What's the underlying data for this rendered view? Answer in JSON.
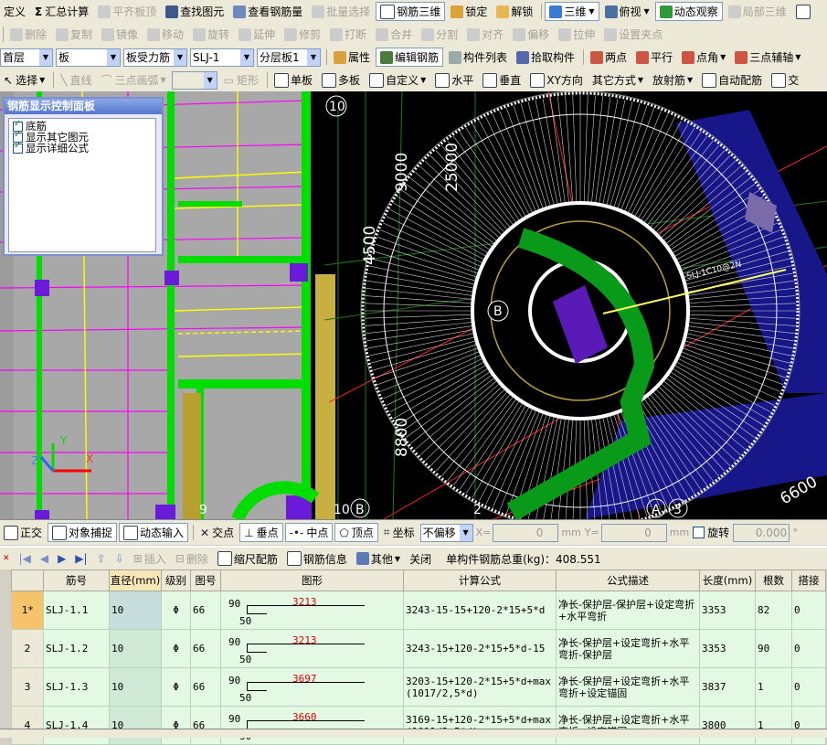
{
  "toolbar1": {
    "items": [
      {
        "label": "定义",
        "enabled": true
      },
      {
        "label": "汇总计算",
        "enabled": true
      },
      {
        "label": "平齐板顶",
        "enabled": false
      },
      {
        "label": "查找图元",
        "enabled": true
      },
      {
        "label": "查看钢筋量",
        "enabled": true
      },
      {
        "label": "批量选择",
        "enabled": false
      },
      {
        "label": "钢筋三维",
        "enabled": true,
        "active": true
      },
      {
        "label": "锁定",
        "enabled": true
      },
      {
        "label": "解锁",
        "enabled": true
      },
      {
        "label": "三维",
        "enabled": true,
        "active": true
      },
      {
        "label": "俯视",
        "enabled": true
      },
      {
        "label": "动态观察",
        "enabled": true,
        "active": true
      },
      {
        "label": "局部三维",
        "enabled": false
      }
    ]
  },
  "toolbar2": {
    "items": [
      "删除",
      "复制",
      "镜像",
      "移动",
      "旋转",
      "延伸",
      "修剪",
      "打断",
      "合并",
      "分割",
      "对齐",
      "偏移",
      "拉伸",
      "设置夹点"
    ]
  },
  "toolbar3": {
    "floor": "首层",
    "type": "板",
    "subtype": "板受力筋",
    "component": "SLJ-1",
    "layer": "分层板1",
    "buttons": [
      "属性",
      "编辑钢筋",
      "构件列表",
      "拾取构件",
      "两点",
      "平行",
      "点角",
      "三点辅轴"
    ],
    "active": "编辑钢筋"
  },
  "toolbar4": {
    "items": [
      "选择",
      "直线",
      "三点画弧",
      "矩形",
      "单板",
      "多板",
      "自定义",
      "水平",
      "垂直",
      "XY方向",
      "其它方式",
      "放射筋",
      "自动配筋",
      "交"
    ]
  },
  "panel": {
    "title": "钢筋显示控制面板",
    "options": [
      "底筋",
      "显示其它图元",
      "显示详细公式"
    ]
  },
  "viewport": {
    "labels": {
      "axis10": "10",
      "dim9000": "9000",
      "dim25000": "25000",
      "dim4500": "4500",
      "dim8800": "8800",
      "dim6600": "6600",
      "axisB": "B",
      "axis9": "9",
      "axis10b": "10",
      "axisB2": "B",
      "axis2": "2",
      "axisA": "A",
      "axis3": "3",
      "barlabel": "SLJ-1C10@2N"
    },
    "colors": {
      "green": "#00dd00",
      "yellow": "#ffff00",
      "magenta": "#ff00ff",
      "purple": "#5a1ab8",
      "white": "#ffffff",
      "red": "#ff0000",
      "gray": "#a0a0a0"
    }
  },
  "statusbar": {
    "items": [
      "正交",
      "对象捕捉",
      "动态输入",
      "交点",
      "垂点",
      "中点",
      "顶点",
      "坐标"
    ],
    "offset": "不偏移",
    "x_label": "X=",
    "x_value": "0",
    "y_label": "Y=",
    "y_value": "0",
    "unit": "mm",
    "rotate_label": "旋转",
    "rotate_value": "0.000",
    "deg": "°"
  },
  "gridbar": {
    "insert": "插入",
    "delete": "删除",
    "scale": "缩尺配筋",
    "info": "钢筋信息",
    "other": "其他",
    "close": "关闭",
    "total": "单构件钢筋总重(kg)：408.551"
  },
  "table": {
    "headers": [
      "筋号",
      "直径(mm)",
      "级别",
      "图号",
      "图形",
      "计算公式",
      "公式描述",
      "长度(mm)",
      "根数",
      "搭接"
    ],
    "rows": [
      {
        "idx": "1*",
        "name": "SLJ-1.1",
        "dia": "10",
        "grade": "Φ",
        "fig": "66",
        "h": "90",
        "w": "50",
        "bend": "3213",
        "formula": "3243-15-15+120-2*15+5*d",
        "desc": "净长-保护层-保护层+设定弯折+水平弯折",
        "len": "3353",
        "count": "82",
        "lap": "0"
      },
      {
        "idx": "2",
        "name": "SLJ-1.2",
        "dia": "10",
        "grade": "Φ",
        "fig": "66",
        "h": "90",
        "w": "50",
        "bend": "3213",
        "formula": "3243-15+120-2*15+5*d-15",
        "desc": "净长-保护层+设定弯折+水平弯折-保护层",
        "len": "3353",
        "count": "90",
        "lap": "0"
      },
      {
        "idx": "3",
        "name": "SLJ-1.3",
        "dia": "10",
        "grade": "Φ",
        "fig": "66",
        "h": "90",
        "w": "50",
        "bend": "3697",
        "formula": "3203-15+120-2*15+5*d+max(1017/2,5*d)",
        "desc": "净长-保护层+设定弯折+水平弯折+设定锚固",
        "len": "3837",
        "count": "1",
        "lap": "0"
      },
      {
        "idx": "4",
        "name": "SLJ-1.4",
        "dia": "10",
        "grade": "Φ",
        "fig": "66",
        "h": "90",
        "w": "50",
        "bend": "3660",
        "formula": "3169-15+120-2*15+5*d+max(1011/2,5*d)",
        "desc": "净长-保护层+设定弯折+水平弯折+设定锚固",
        "len": "3800",
        "count": "1",
        "lap": "0"
      }
    ]
  }
}
